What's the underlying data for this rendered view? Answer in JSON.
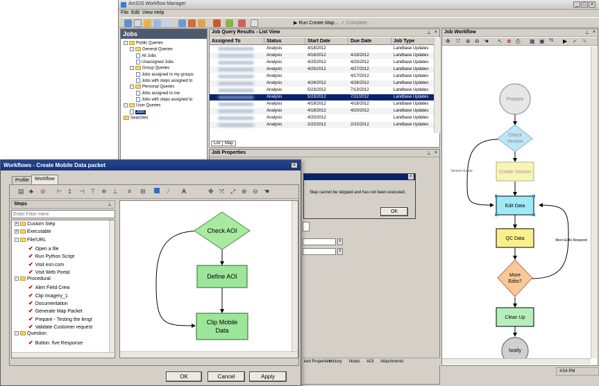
{
  "app": {
    "title": "ArcGIS Workflow Manager",
    "clock": "4:54 PM"
  },
  "menu": [
    "File",
    "Edit",
    "View",
    "Help"
  ],
  "toolbar": {
    "run_label": "Run Create Map...",
    "complete_label": "Complete..."
  },
  "jobs_panel": {
    "title": "Jobs",
    "tree": [
      {
        "label": "Public Queries",
        "level": 0,
        "type": "folder",
        "expand": "-"
      },
      {
        "label": "General Queries",
        "level": 1,
        "type": "folder",
        "expand": "-"
      },
      {
        "label": "All Jobs",
        "level": 2,
        "type": "doc"
      },
      {
        "label": "Unassigned Jobs",
        "level": 2,
        "type": "doc"
      },
      {
        "label": "Group Queries",
        "level": 1,
        "type": "folder",
        "expand": "-"
      },
      {
        "label": "Jobs assigned to my groups",
        "level": 2,
        "type": "doc"
      },
      {
        "label": "Jobs with steps assigned to",
        "level": 2,
        "type": "doc"
      },
      {
        "label": "Personal Queries",
        "level": 1,
        "type": "folder",
        "expand": "-"
      },
      {
        "label": "Jobs assigned to me",
        "level": 2,
        "type": "doc"
      },
      {
        "label": "Jobs with steps assigned to",
        "level": 2,
        "type": "doc"
      },
      {
        "label": "User Queries",
        "level": 0,
        "type": "folder",
        "expand": "-"
      },
      {
        "label": "Jobs",
        "level": 1,
        "type": "doc",
        "selected": true
      },
      {
        "label": "Searches",
        "level": 0,
        "type": "folder"
      }
    ]
  },
  "query_results": {
    "title": "Job Query Results - List View",
    "columns": [
      "Assigned To",
      "Status",
      "Start Date",
      "Due Date",
      "Job Type"
    ],
    "rows": [
      [
        "",
        "Analysis",
        "4/18/2012",
        "",
        "Landbase Updates"
      ],
      [
        "",
        "Analysis",
        "4/16/2012",
        "4/18/2012",
        "Landbase Updates"
      ],
      [
        "",
        "Analysis",
        "4/25/2012",
        "4/25/2012",
        "Landbase Updates"
      ],
      [
        "",
        "Analysis",
        "4/25/2012",
        "4/27/2012",
        "Landbase Updates"
      ],
      [
        "",
        "Analysis",
        "",
        "4/17/2012",
        "Landbase Updates"
      ],
      [
        "",
        "Analysis",
        "4/24/2012",
        "4/26/2012",
        "Landbase Updates"
      ],
      [
        "",
        "Analysis",
        "5/23/2012",
        "7/13/2012",
        "Landbase Updates"
      ],
      [
        "",
        "Analysis",
        "5/23/2012",
        "7/11/2012",
        "Landbase Updates"
      ],
      [
        "",
        "Analysis",
        "4/18/2012",
        "4/18/2012",
        "Landbase Updates"
      ],
      [
        "",
        "Analysis",
        "4/18/2012",
        "4/20/2012",
        "Landbase Updates"
      ],
      [
        "",
        "Analysis",
        "4/20/2012",
        "",
        "Landbase Updates"
      ],
      [
        "",
        "Analysis",
        "2/22/2012",
        "2/22/2012",
        "Landbase Updates"
      ]
    ],
    "selected_row": 7,
    "tabs": [
      "List",
      "Map"
    ]
  },
  "job_properties": {
    "title": "Job Properties"
  },
  "message": {
    "text": "Step cannot be skipped and has not been executed.",
    "ok_label": "OK"
  },
  "bottom_tabs": [
    "ked Properties",
    "History",
    "Notes",
    "AOI",
    "Attachments"
  ],
  "job_workflow": {
    "title": "Job Workflow",
    "nodes": {
      "prepare": "Prepare",
      "check_version": "Check Version",
      "create_version": "Create Version",
      "edit_data": "Edit Data",
      "qc_data": "QC Data",
      "more_edits": "More Edits?",
      "clean_up": "Clean Up",
      "notify": "Notify"
    },
    "labels": {
      "version_exists": "Version Exists",
      "more_edits_required": "More Edits Required"
    }
  },
  "dialog": {
    "title": "Workflows - Create Mobile Data packet",
    "tabs": [
      "Profile",
      "Workflow"
    ],
    "steps_title": "Steps",
    "filter_placeholder": "Enter Filter Here",
    "steps": [
      {
        "label": "Custom Step",
        "level": 0,
        "type": "folder",
        "expand": "+"
      },
      {
        "label": "Executable",
        "level": 0,
        "type": "folder",
        "expand": "+"
      },
      {
        "label": "File/URL",
        "level": 0,
        "type": "folder",
        "expand": "-"
      },
      {
        "label": "Open a file",
        "level": 1,
        "type": "step"
      },
      {
        "label": "Run Python Script",
        "level": 1,
        "type": "step"
      },
      {
        "label": "Visit esri.com",
        "level": 1,
        "type": "step"
      },
      {
        "label": "Visit Web Portal",
        "level": 1,
        "type": "step"
      },
      {
        "label": "Procedural",
        "level": 0,
        "type": "folder",
        "expand": "-"
      },
      {
        "label": "Alert Field Crew",
        "level": 1,
        "type": "step"
      },
      {
        "label": "Clip Imagery_1",
        "level": 1,
        "type": "step"
      },
      {
        "label": "Documentation",
        "level": 1,
        "type": "step"
      },
      {
        "label": "Generate Map Packet",
        "level": 1,
        "type": "step"
      },
      {
        "label": "Prepare - Testing the lengt",
        "level": 1,
        "type": "step"
      },
      {
        "label": "Validate Customer request",
        "level": 1,
        "type": "step"
      },
      {
        "label": "Question",
        "level": 0,
        "type": "folder",
        "expand": "-"
      },
      {
        "label": "Button: five Response",
        "level": 1,
        "type": "step"
      }
    ],
    "diagram": {
      "check_aoi": "Check AOI",
      "define_aoi": "Define AOI",
      "clip_mobile": "Clip Mobile Data"
    },
    "buttons": {
      "ok": "OK",
      "cancel": "Cancel",
      "apply": "Apply"
    }
  },
  "colors": {
    "dialog_title": "#1e3e86",
    "selection": "#0a246a",
    "diamond_green": "#a8eaa0",
    "node_green": "#9be69b",
    "prepare_gray": "#e6e6e6",
    "check_blue": "#bfe6f8",
    "create_yellow": "#f8f4b8",
    "edit_cyan": "#9eeaf7",
    "qc_yellow": "#f7f08c",
    "more_orange": "#f8c89a",
    "clean_green": "#b6eebb",
    "notify_gray": "#d0d0d0"
  }
}
